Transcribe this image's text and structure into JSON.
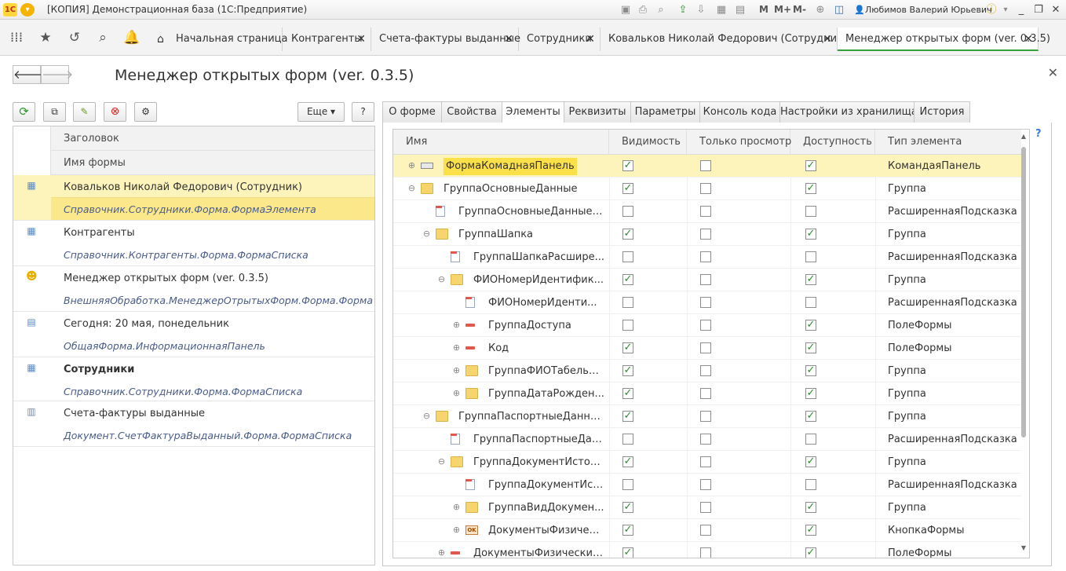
{
  "window": {
    "title": "[КОПИЯ] Демонстрационная база (1С:Предприятие)",
    "logo": "1С",
    "user": "Любимов Валерий Юрьевич",
    "mem_buttons": [
      "M",
      "M+",
      "M-"
    ]
  },
  "tabs": [
    {
      "label": "Начальная страница",
      "closable": false
    },
    {
      "label": "Контрагенты",
      "closable": true
    },
    {
      "label": "Счета-фактуры выданные",
      "closable": true
    },
    {
      "label": "Сотрудники",
      "closable": true
    },
    {
      "label": "Ковальков  Николай Федорович (Сотрудник)",
      "closable": true
    },
    {
      "label": "Менеджер открытых форм (ver. 0.3.5)",
      "closable": true,
      "active": true
    }
  ],
  "form": {
    "title": "Менеджер открытых форм (ver. 0.3.5)",
    "more_label": "Еще",
    "help_label": "?"
  },
  "left_table": {
    "header_caption": "Заголовок",
    "header_form": "Имя формы",
    "rows": [
      {
        "caption": "Ковальков  Николай Федорович (Сотрудник)",
        "form_name": "Справочник.Сотрудники.Форма.ФормаЭлемента",
        "icon": "table-icon",
        "selected": true
      },
      {
        "caption": "Контрагенты",
        "form_name": "Справочник.Контрагенты.Форма.ФормаСписка",
        "icon": "table-icon"
      },
      {
        "caption": "Менеджер открытых форм (ver. 0.3.5)",
        "form_name": "ВнешняяОбработка.МенеджерОтрытыхФорм.Форма.Форма",
        "icon": "smiley-icon"
      },
      {
        "caption": "Сегодня: 20 мая, понедельник",
        "form_name": "ОбщаяФорма.ИнформационнаяПанель",
        "icon": "info-panel-icon"
      },
      {
        "caption": "Сотрудники",
        "form_name": "Справочник.Сотрудники.Форма.ФормаСписка",
        "icon": "table-icon",
        "bold": true
      },
      {
        "caption": "Счета-фактуры выданные",
        "form_name": "Документ.СчетФактураВыданный.Форма.ФормаСписка",
        "icon": "document-icon"
      }
    ]
  },
  "right_tabs": [
    "О форме",
    "Свойства",
    "Элементы",
    "Реквизиты",
    "Параметры",
    "Консоль кода",
    "Настройки из хранилища",
    "История"
  ],
  "active_right_tab": "Элементы",
  "help_mark": "?",
  "elements": {
    "columns": [
      "Имя",
      "Видимость",
      "Только просмотр",
      "Доступность",
      "Тип элемента"
    ],
    "rows": [
      {
        "name": "ФормаКомаднаяПанель",
        "expander": "plus",
        "icon": "command-panel-icon",
        "visible": true,
        "readonly": false,
        "enabled": true,
        "type": "КомандаяПанель",
        "selected": true
      },
      {
        "name": "ГруппаОсновныеДанные",
        "expander": "minus",
        "icon": "folder-icon",
        "visible": true,
        "readonly": false,
        "enabled": true,
        "type": "Группа"
      },
      {
        "name": "ГруппаОсновныеДанныеР...",
        "expander": "",
        "icon": "hint-icon",
        "visible": false,
        "readonly": false,
        "enabled": false,
        "type": "РасширеннаяПодсказка"
      },
      {
        "name": "ГруппаШапка",
        "expander": "minus",
        "icon": "folder-icon",
        "visible": true,
        "readonly": false,
        "enabled": true,
        "type": "Группа"
      },
      {
        "name": "ГруппаШапкаРасшире...",
        "expander": "",
        "icon": "hint-icon",
        "visible": false,
        "readonly": false,
        "enabled": false,
        "type": "РасширеннаяПодсказка"
      },
      {
        "name": "ФИОНомерИдентифик...",
        "expander": "minus",
        "icon": "folder-icon",
        "visible": true,
        "readonly": false,
        "enabled": true,
        "type": "Группа"
      },
      {
        "name": "ФИОНомерИденти...",
        "expander": "",
        "icon": "hint-icon",
        "visible": false,
        "readonly": false,
        "enabled": false,
        "type": "РасширеннаяПодсказка"
      },
      {
        "name": "ГруппаДоступа",
        "expander": "plus",
        "icon": "field-icon",
        "visible": false,
        "readonly": false,
        "enabled": true,
        "type": "ПолеФормы"
      },
      {
        "name": "Код",
        "expander": "plus",
        "icon": "field-icon",
        "visible": true,
        "readonly": false,
        "enabled": true,
        "type": "ПолеФормы"
      },
      {
        "name": "ГруппаФИОТабельн...",
        "expander": "plus",
        "icon": "folder-icon",
        "visible": true,
        "readonly": false,
        "enabled": true,
        "type": "Группа"
      },
      {
        "name": "ГруппаДатаРожден...",
        "expander": "plus",
        "icon": "folder-icon",
        "visible": true,
        "readonly": false,
        "enabled": true,
        "type": "Группа"
      },
      {
        "name": "ГруппаПаспортныеДанные",
        "expander": "minus",
        "icon": "folder-icon",
        "visible": true,
        "readonly": false,
        "enabled": true,
        "type": "Группа"
      },
      {
        "name": "ГруппаПаспортныеДан...",
        "expander": "",
        "icon": "hint-icon",
        "visible": false,
        "readonly": false,
        "enabled": false,
        "type": "РасширеннаяПодсказка"
      },
      {
        "name": "ГруппаДокументИстория",
        "expander": "minus",
        "icon": "folder-icon",
        "visible": true,
        "readonly": false,
        "enabled": true,
        "type": "Группа"
      },
      {
        "name": "ГруппаДокументИст...",
        "expander": "",
        "icon": "hint-icon",
        "visible": false,
        "readonly": false,
        "enabled": false,
        "type": "РасширеннаяПодсказка"
      },
      {
        "name": "ГруппаВидДокумен...",
        "expander": "plus",
        "icon": "folder-icon",
        "visible": true,
        "readonly": false,
        "enabled": true,
        "type": "Группа"
      },
      {
        "name": "ДокументыФизичес...",
        "expander": "plus",
        "icon": "ok-button-icon",
        "visible": true,
        "readonly": false,
        "enabled": true,
        "type": "КнопкаФормы"
      },
      {
        "name": "ДокументыФизических...",
        "expander": "plus",
        "icon": "field-icon",
        "visible": true,
        "readonly": false,
        "enabled": true,
        "type": "ПолеФормы"
      }
    ]
  }
}
